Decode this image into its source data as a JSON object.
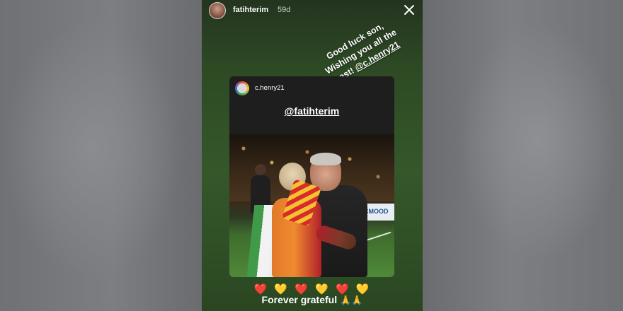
{
  "story": {
    "username": "fatihterim",
    "time_ago": "59d",
    "close_icon": "close-icon",
    "caption_lines": [
      "Good luck son,",
      "Wishing you all the",
      "best! "
    ],
    "caption_mention": "@c.henry21",
    "shared_post": {
      "username": "c.henry21",
      "mention": "@fatihterim",
      "adboard_text": "MACMOOD"
    },
    "hearts": [
      "❤️",
      "💛",
      "❤️",
      "💛",
      "❤️",
      "💛"
    ],
    "footer_text": "Forever grateful",
    "footer_emoji": "🙏🙏"
  }
}
